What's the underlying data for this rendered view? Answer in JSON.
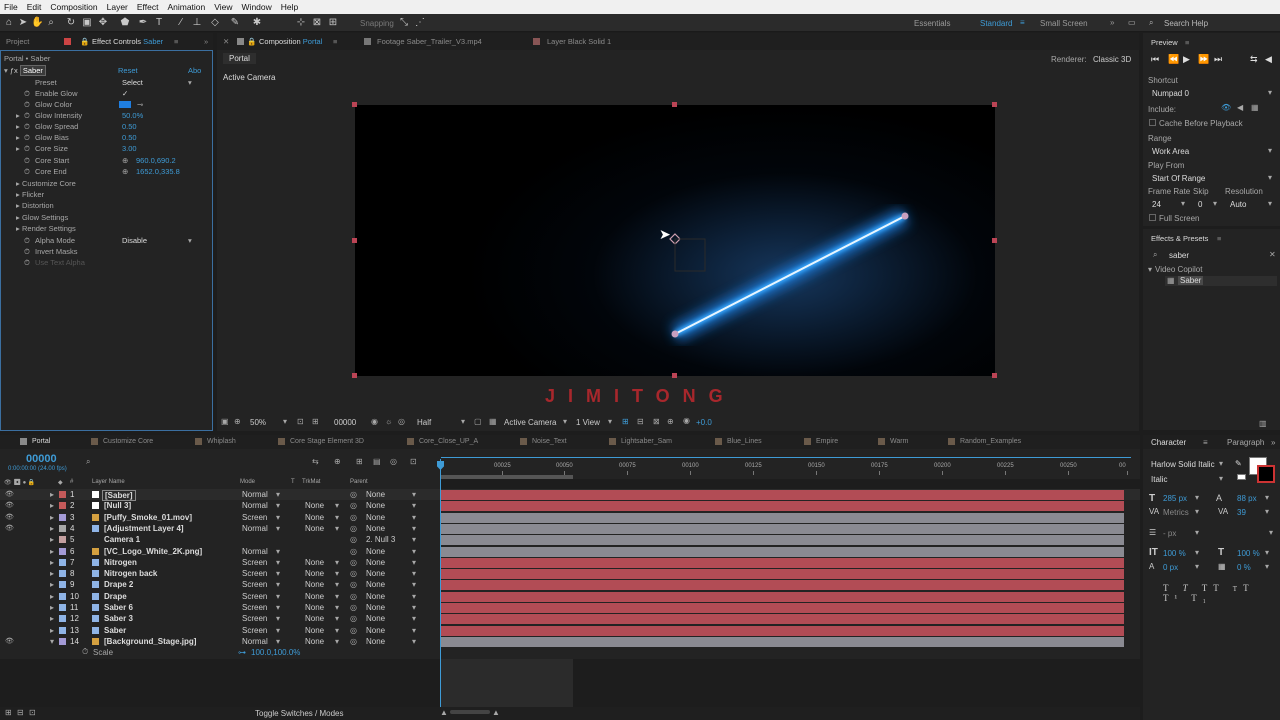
{
  "menu": [
    "File",
    "Edit",
    "Composition",
    "Layer",
    "Effect",
    "Animation",
    "View",
    "Window",
    "Help"
  ],
  "toolbar": {
    "snapping": "Snapping",
    "workspaces": [
      "Essentials",
      "Standard",
      "Small Screen"
    ],
    "search": "Search Help"
  },
  "left": {
    "tab_project": "Project",
    "tab_effect": "Effect Controls",
    "tab_effect_target": "Saber",
    "breadcrumb": "Portal • Saber",
    "effect_name": "Saber",
    "reset": "Reset",
    "about": "Abo",
    "props": [
      {
        "name": "Preset",
        "value": "Select"
      },
      {
        "name": "Enable Glow",
        "value": "✓"
      },
      {
        "name": "Glow Color",
        "value": ""
      },
      {
        "name": "Glow Intensity",
        "value": "50.0%"
      },
      {
        "name": "Glow Spread",
        "value": "0.50"
      },
      {
        "name": "Glow Bias",
        "value": "0.50"
      },
      {
        "name": "Core Size",
        "value": "3.00"
      },
      {
        "name": "Core Start",
        "value": "960.0,690.2"
      },
      {
        "name": "Core End",
        "value": "1652.0,335.8"
      },
      {
        "name": "Customize Core",
        "value": ""
      },
      {
        "name": "Flicker",
        "value": ""
      },
      {
        "name": "Distortion",
        "value": ""
      },
      {
        "name": "Glow Settings",
        "value": ""
      },
      {
        "name": "Render Settings",
        "value": ""
      },
      {
        "name": "Alpha Mode",
        "value": "Disable"
      },
      {
        "name": "Invert Masks",
        "value": ""
      },
      {
        "name": "Use Text Alpha",
        "value": ""
      }
    ]
  },
  "comp": {
    "tab_comp": "Composition",
    "tab_comp_name": "Portal",
    "tab_footage": "Footage Saber_Trailer_V3.mp4",
    "tab_layer": "Layer Black Solid 1",
    "sub_tab": "Portal",
    "renderer_label": "Renderer:",
    "renderer": "Classic 3D",
    "active_camera": "Active Camera",
    "watermark": "JIMITONG",
    "bottom": {
      "zoom": "50%",
      "time": "00000",
      "resolution": "Half",
      "camera": "Active Camera",
      "views": "1 View",
      "exposure": "+0.0"
    }
  },
  "preview": {
    "title": "Preview",
    "shortcut_label": "Shortcut",
    "shortcut": "Numpad 0",
    "include": "Include:",
    "cache": "Cache Before Playback",
    "range_label": "Range",
    "range": "Work Area",
    "play_from_label": "Play From",
    "play_from": "Start Of Range",
    "frame_rate_label": "Frame Rate",
    "skip_label": "Skip",
    "resolution_label": "Resolution",
    "frame_rate": "24",
    "skip": "0",
    "resolution": "Auto",
    "full_screen": "Full Screen"
  },
  "effects": {
    "title": "Effects & Presets",
    "search": "saber",
    "folder": "Video Copilot",
    "item": "Saber"
  },
  "timeline": {
    "tabs": [
      "Portal",
      "Customize Core",
      "Whiplash",
      "Core Stage Element 3D",
      "Core_Close_UP_A",
      "Noise_Text",
      "Lightsaber_Sam",
      "Blue_Lines",
      "Empire",
      "Warm",
      "Random_Examples"
    ],
    "timecode": "00000",
    "fps": "0:00:00:00 (24.00 fps)",
    "col_layer": "Layer Name",
    "col_mode": "Mode",
    "col_t": "T",
    "col_trkmat": "TrkMat",
    "col_parent": "Parent",
    "ruler": [
      "00025",
      "00050",
      "00075",
      "00100",
      "00125",
      "00150",
      "00175",
      "00200",
      "00225",
      "00250",
      "00"
    ],
    "layers": [
      {
        "num": "1",
        "name": "[Saber]",
        "mode": "Normal",
        "trk": "",
        "parent": "None",
        "color": "#c45a5a",
        "icon": "solid"
      },
      {
        "num": "2",
        "name": "[Null 3]",
        "mode": "Normal",
        "trk": "None",
        "parent": "None",
        "color": "#c45a5a",
        "icon": "solid"
      },
      {
        "num": "3",
        "name": "[Puffy_Smoke_01.mov]",
        "mode": "Screen",
        "trk": "None",
        "parent": "None",
        "color": "#a39ad6",
        "icon": "footage"
      },
      {
        "num": "4",
        "name": "[Adjustment Layer 4]",
        "mode": "Normal",
        "trk": "None",
        "parent": "None",
        "color": "#a8a8a8",
        "icon": "solid"
      },
      {
        "num": "5",
        "name": "Camera 1",
        "mode": "",
        "trk": "",
        "parent": "2. Null 3",
        "color": "#c4a0a0",
        "icon": "camera"
      },
      {
        "num": "6",
        "name": "[VC_Logo_White_2K.png]",
        "mode": "Normal",
        "trk": "",
        "parent": "None",
        "color": "#a39ad6",
        "icon": "footage"
      },
      {
        "num": "7",
        "name": "Nitrogen",
        "mode": "Screen",
        "trk": "None",
        "parent": "None",
        "color": "#8fb4e6",
        "icon": "solid"
      },
      {
        "num": "8",
        "name": "Nitrogen back",
        "mode": "Screen",
        "trk": "None",
        "parent": "None",
        "color": "#8fb4e6",
        "icon": "solid"
      },
      {
        "num": "9",
        "name": "Drape 2",
        "mode": "Screen",
        "trk": "None",
        "parent": "None",
        "color": "#8fb4e6",
        "icon": "solid"
      },
      {
        "num": "10",
        "name": "Drape",
        "mode": "Screen",
        "trk": "None",
        "parent": "None",
        "color": "#8fb4e6",
        "icon": "solid"
      },
      {
        "num": "11",
        "name": "Saber 6",
        "mode": "Screen",
        "trk": "None",
        "parent": "None",
        "color": "#8fb4e6",
        "icon": "solid"
      },
      {
        "num": "12",
        "name": "Saber 3",
        "mode": "Screen",
        "trk": "None",
        "parent": "None",
        "color": "#8fb4e6",
        "icon": "solid"
      },
      {
        "num": "13",
        "name": "Saber",
        "mode": "Screen",
        "trk": "None",
        "parent": "None",
        "color": "#8fb4e6",
        "icon": "solid"
      },
      {
        "num": "14",
        "name": "[Background_Stage.jpg]",
        "mode": "Normal",
        "trk": "None",
        "parent": "None",
        "color": "#a39ad6",
        "icon": "footage"
      }
    ],
    "scale_label": "Scale",
    "scale_value": "100.0,100.0%",
    "toggle": "Toggle Switches / Modes"
  },
  "character": {
    "title": "Character",
    "tab2": "Paragraph",
    "font": "Harlow Solid Italic",
    "style": "Italic",
    "size": "285 px",
    "leading": "88 px",
    "kerning": "Metrics",
    "tracking": "39",
    "stroke": "- px",
    "vscale": "100 %",
    "hscale": "100 %",
    "baseline": "0 px",
    "tsume": "0 %"
  },
  "colors": {
    "accent": "#3e9bd6",
    "saber_glow": "#39a8ff",
    "bar_red": "#b24c55",
    "watermark": "#c0282e"
  }
}
